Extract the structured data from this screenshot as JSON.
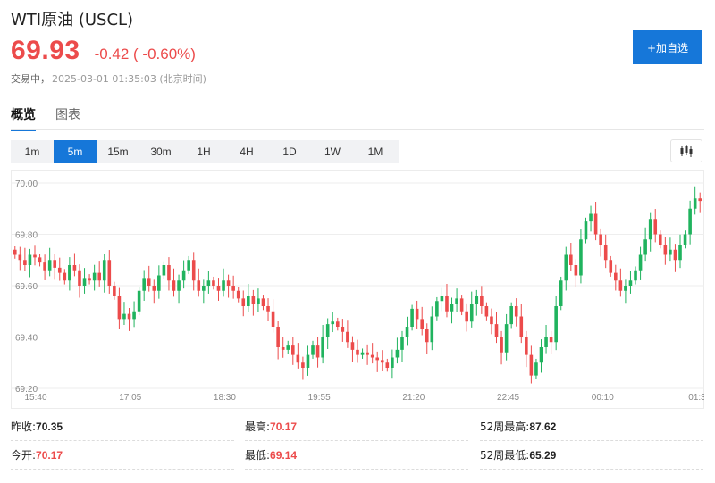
{
  "header": {
    "title": "WTI原油 (USCL)",
    "price": "69.93",
    "change": "-0.42 ( -0.60%)",
    "status": "交易中，",
    "timestamp": "2025-03-01 01:35:03 (北京时间)",
    "add_button": "+加自选"
  },
  "tabs": [
    {
      "label": "概览",
      "active": true
    },
    {
      "label": "图表",
      "active": false
    }
  ],
  "timeframes": [
    {
      "label": "1m",
      "active": false
    },
    {
      "label": "5m",
      "active": true
    },
    {
      "label": "15m",
      "active": false
    },
    {
      "label": "30m",
      "active": false
    },
    {
      "label": "1H",
      "active": false
    },
    {
      "label": "4H",
      "active": false
    },
    {
      "label": "1D",
      "active": false
    },
    {
      "label": "1W",
      "active": false
    },
    {
      "label": "1M",
      "active": false
    }
  ],
  "chart_icon": "candlestick-icon",
  "colors": {
    "up": "#20b35e",
    "down": "#ec4b4b",
    "accent": "#1677d9"
  },
  "chart_data": {
    "type": "candlestick",
    "ylim": [
      69.2,
      70.0
    ],
    "yticks": [
      "70.00",
      "69.80",
      "69.60",
      "69.40",
      "69.20"
    ],
    "xticks": [
      "15:40",
      "17:05",
      "18:30",
      "19:55",
      "21:20",
      "22:45",
      "00:10",
      "01:3"
    ],
    "grid": true,
    "closes": [
      69.72,
      69.7,
      69.68,
      69.72,
      69.71,
      69.69,
      69.66,
      69.7,
      69.67,
      69.65,
      69.62,
      69.68,
      69.66,
      69.6,
      69.63,
      69.62,
      69.65,
      69.62,
      69.7,
      69.6,
      69.56,
      69.47,
      69.49,
      69.47,
      69.5,
      69.58,
      69.63,
      69.6,
      69.58,
      69.64,
      69.68,
      69.62,
      69.58,
      69.62,
      69.66,
      69.7,
      69.62,
      69.58,
      69.6,
      69.62,
      69.6,
      69.58,
      69.62,
      69.6,
      69.58,
      69.55,
      69.52,
      69.56,
      69.53,
      69.55,
      69.52,
      69.5,
      69.44,
      69.36,
      69.35,
      69.37,
      69.33,
      69.3,
      69.28,
      69.33,
      69.37,
      69.32,
      69.4,
      69.45,
      69.46,
      69.44,
      69.42,
      69.38,
      69.35,
      69.33,
      69.34,
      69.33,
      69.32,
      69.31,
      69.3,
      69.28,
      69.32,
      69.35,
      69.4,
      69.44,
      69.51,
      69.47,
      69.43,
      69.38,
      69.48,
      69.54,
      69.56,
      69.5,
      69.53,
      69.55,
      69.5,
      69.46,
      69.53,
      69.56,
      69.52,
      69.48,
      69.45,
      69.4,
      69.34,
      69.45,
      69.52,
      69.48,
      69.4,
      69.33,
      69.25,
      69.3,
      69.36,
      69.4,
      69.38,
      69.52,
      69.62,
      69.72,
      69.68,
      69.64,
      69.78,
      69.85,
      69.88,
      69.8,
      69.76,
      69.7,
      69.65,
      69.62,
      69.58,
      69.6,
      69.62,
      69.66,
      69.72,
      69.78,
      69.86,
      69.8,
      69.76,
      69.72,
      69.74,
      69.7,
      69.76,
      69.8,
      69.9,
      69.94,
      69.93
    ]
  },
  "stats": [
    {
      "label": "昨收:",
      "value": "70.35",
      "color": "dark"
    },
    {
      "label": "最高:",
      "value": "70.17",
      "color": "red"
    },
    {
      "label": "52周最高:",
      "value": "87.62",
      "color": "dark"
    },
    {
      "label": "今开:",
      "value": "70.17",
      "color": "red"
    },
    {
      "label": "最低:",
      "value": "69.14",
      "color": "red"
    },
    {
      "label": "52周最低:",
      "value": "65.29",
      "color": "dark"
    }
  ]
}
